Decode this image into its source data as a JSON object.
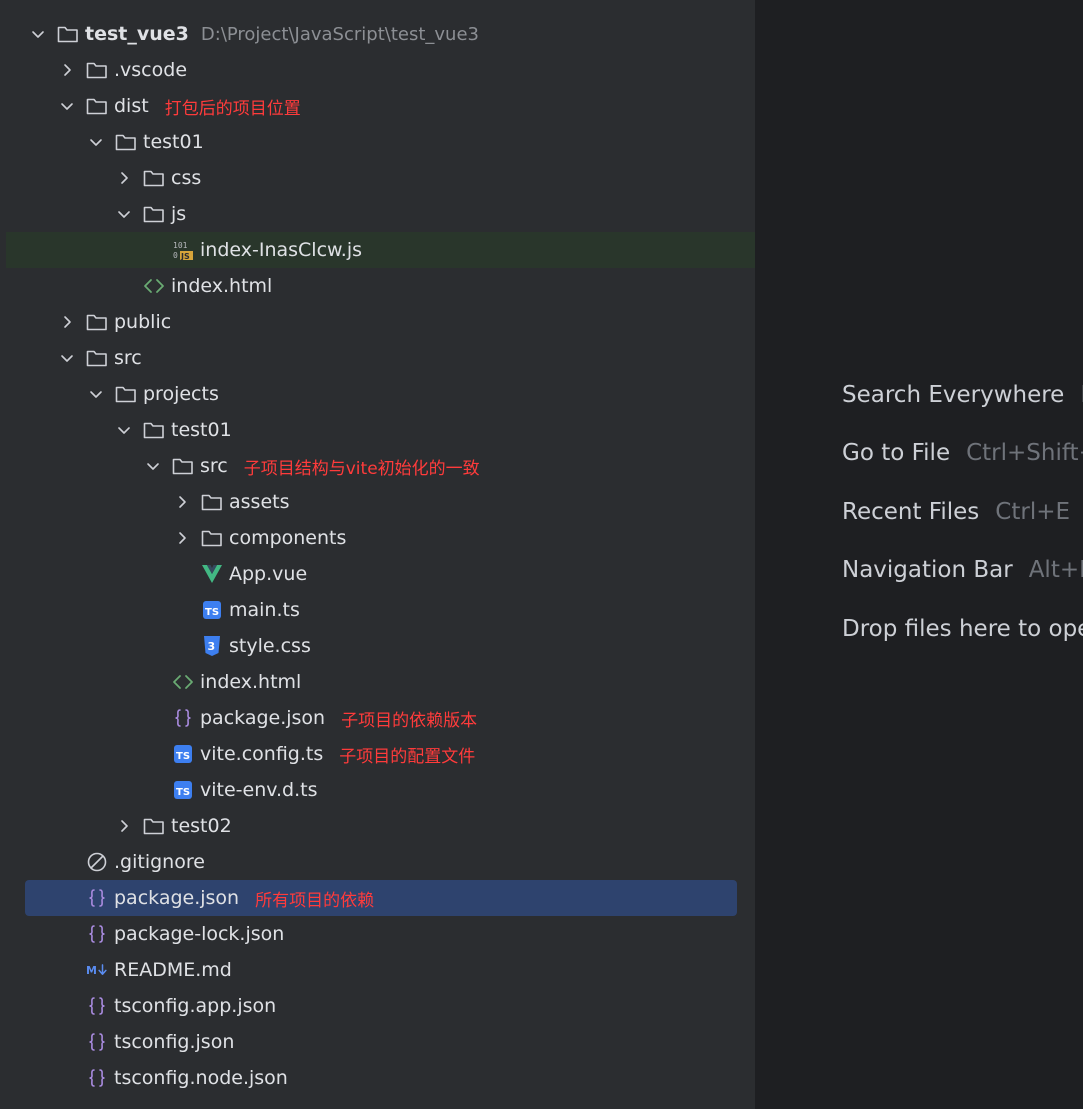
{
  "tree": [
    {
      "id": "root",
      "name": "test_vue3",
      "path": "D:\\Project\\JavaScript\\test_vue3",
      "icon": "folder-icon",
      "chevron": "down",
      "depth": 0,
      "bold": true
    },
    {
      "id": "vscode",
      "name": ".vscode",
      "icon": "folder-icon",
      "chevron": "right",
      "depth": 1
    },
    {
      "id": "dist",
      "name": "dist",
      "icon": "folder-icon",
      "chevron": "down",
      "depth": 1,
      "note": "打包后的项目位置"
    },
    {
      "id": "dist-test01",
      "name": "test01",
      "icon": "folder-icon",
      "chevron": "down",
      "depth": 2
    },
    {
      "id": "css",
      "name": "css",
      "icon": "folder-icon",
      "chevron": "right",
      "depth": 3
    },
    {
      "id": "js",
      "name": "js",
      "icon": "folder-icon",
      "chevron": "down",
      "depth": 3
    },
    {
      "id": "index-js",
      "name": "index-InasClcw.js",
      "icon": "minified-js-icon",
      "depth": 4,
      "highlight": "green"
    },
    {
      "id": "dist-index-html",
      "name": "index.html",
      "icon": "html-icon",
      "depth": 3
    },
    {
      "id": "public",
      "name": "public",
      "icon": "folder-icon",
      "chevron": "right",
      "depth": 1
    },
    {
      "id": "src",
      "name": "src",
      "icon": "folder-icon",
      "chevron": "down",
      "depth": 1
    },
    {
      "id": "projects",
      "name": "projects",
      "icon": "folder-icon",
      "chevron": "down",
      "depth": 2
    },
    {
      "id": "proj-test01",
      "name": "test01",
      "icon": "folder-icon",
      "chevron": "down",
      "depth": 3
    },
    {
      "id": "proj-src",
      "name": "src",
      "icon": "folder-icon",
      "chevron": "down",
      "depth": 4,
      "note": "子项目结构与vite初始化的一致"
    },
    {
      "id": "assets",
      "name": "assets",
      "icon": "folder-icon",
      "chevron": "right",
      "depth": 5
    },
    {
      "id": "components",
      "name": "components",
      "icon": "folder-icon",
      "chevron": "right",
      "depth": 5
    },
    {
      "id": "app-vue",
      "name": "App.vue",
      "icon": "vue-icon",
      "depth": 5
    },
    {
      "id": "main-ts",
      "name": "main.ts",
      "icon": "typescript-icon",
      "depth": 5
    },
    {
      "id": "style-css",
      "name": "style.css",
      "icon": "css-icon",
      "depth": 5
    },
    {
      "id": "proj-index-html",
      "name": "index.html",
      "icon": "html-icon",
      "depth": 4
    },
    {
      "id": "proj-package-json",
      "name": "package.json",
      "icon": "json-icon",
      "depth": 4,
      "note": "子项目的依赖版本"
    },
    {
      "id": "vite-config",
      "name": "vite.config.ts",
      "icon": "typescript-icon",
      "depth": 4,
      "note": "子项目的配置文件"
    },
    {
      "id": "vite-env",
      "name": "vite-env.d.ts",
      "icon": "typescript-icon",
      "depth": 4
    },
    {
      "id": "test02",
      "name": "test02",
      "icon": "folder-icon",
      "chevron": "right",
      "depth": 3
    },
    {
      "id": "gitignore",
      "name": ".gitignore",
      "icon": "ignore-icon",
      "depth": 1
    },
    {
      "id": "root-package-json",
      "name": "package.json",
      "icon": "json-icon",
      "depth": 1,
      "note": "所有项目的依赖",
      "highlight": "selected"
    },
    {
      "id": "package-lock",
      "name": "package-lock.json",
      "icon": "json-icon",
      "depth": 1
    },
    {
      "id": "readme",
      "name": "README.md",
      "icon": "markdown-icon",
      "depth": 1
    },
    {
      "id": "tsconfig-app",
      "name": "tsconfig.app.json",
      "icon": "json-icon",
      "depth": 1
    },
    {
      "id": "tsconfig",
      "name": "tsconfig.json",
      "icon": "json-icon",
      "depth": 1
    },
    {
      "id": "tsconfig-node",
      "name": "tsconfig.node.json",
      "icon": "json-icon",
      "depth": 1
    }
  ],
  "editor_hints": [
    {
      "id": "search-everywhere",
      "label": "Search Everywhere",
      "keys": "Double Shift"
    },
    {
      "id": "go-to-file",
      "label": "Go to File",
      "keys": "Ctrl+Shift+N"
    },
    {
      "id": "recent-files",
      "label": "Recent Files",
      "keys": "Ctrl+E"
    },
    {
      "id": "navigation-bar",
      "label": "Navigation Bar",
      "keys": "Alt+Home"
    },
    {
      "id": "drop-files",
      "label": "Drop files here to open them",
      "keys": ""
    }
  ],
  "colors": {
    "panel_bg": "#2b2d30",
    "editor_bg": "#1e1f22",
    "selection": "#2e436e",
    "green_highlight": "#29362b",
    "annotation": "#ff3b3b",
    "folder": "#ced0d6",
    "html_icon": "#6aab73",
    "vue_icon": "#42b883",
    "ts_icon": "#3d7ff0",
    "json_icon": "#a98bdf"
  }
}
